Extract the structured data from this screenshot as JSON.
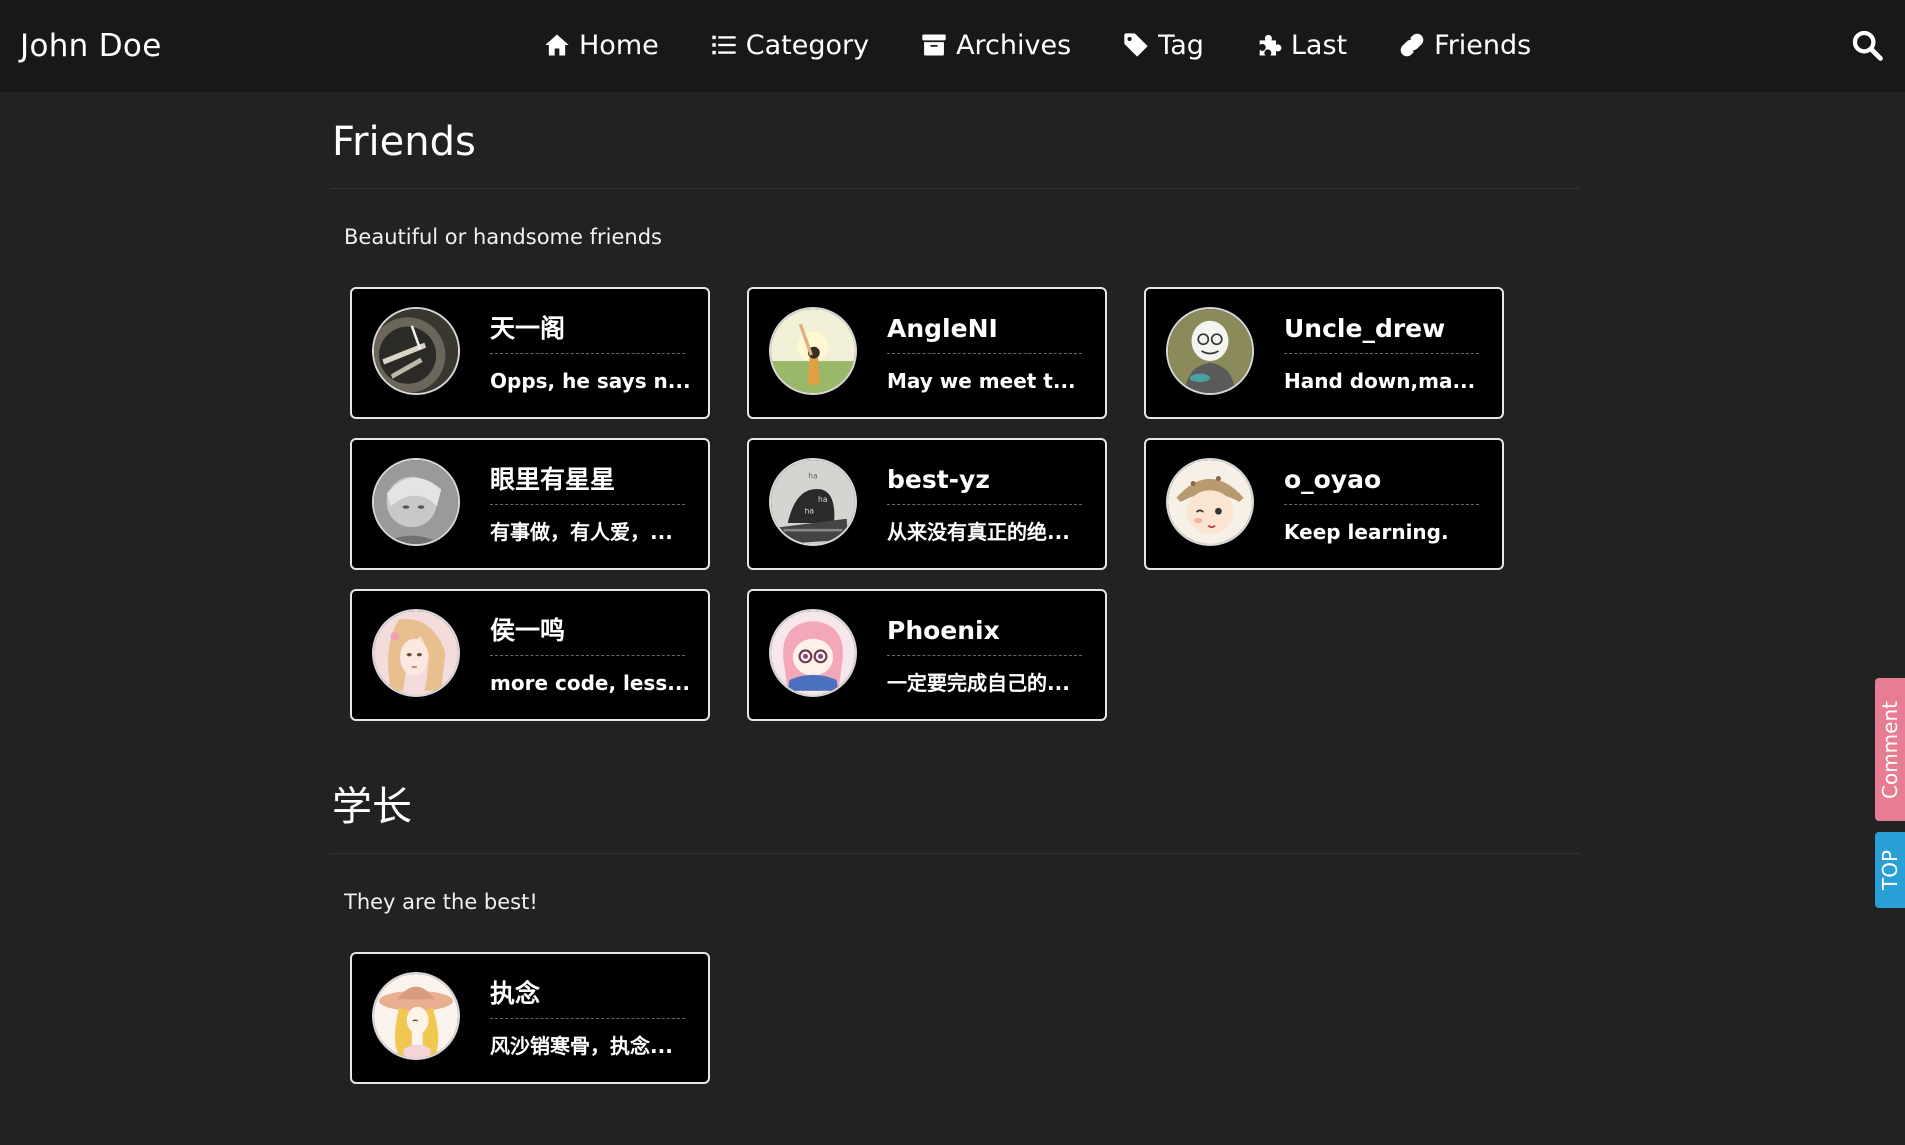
{
  "brand": "John Doe",
  "nav": [
    {
      "label": "Home",
      "icon": "home-icon"
    },
    {
      "label": "Category",
      "icon": "list-icon"
    },
    {
      "label": "Archives",
      "icon": "archive-icon"
    },
    {
      "label": "Tag",
      "icon": "tag-icon"
    },
    {
      "label": "Last",
      "icon": "puzzle-icon"
    },
    {
      "label": "Friends",
      "icon": "link-icon"
    }
  ],
  "search_icon": "search-icon",
  "sections": [
    {
      "title": "Friends",
      "description": "Beautiful or handsome friends",
      "friends": [
        {
          "name": "天一阁",
          "desc": "Opps, he says n..."
        },
        {
          "name": "AngleNI",
          "desc": "May we meet t..."
        },
        {
          "name": "Uncle_drew",
          "desc": "Hand down,ma..."
        },
        {
          "name": "眼里有星星",
          "desc": "有事做，有人爱，..."
        },
        {
          "name": "best-yz",
          "desc": "从来没有真正的绝..."
        },
        {
          "name": "o_oyao",
          "desc": "Keep learning."
        },
        {
          "name": "侯一鸣",
          "desc": "more code, less..."
        },
        {
          "name": "Phoenix",
          "desc": "一定要完成自己的..."
        }
      ]
    },
    {
      "title": "学长",
      "description": "They are the best!",
      "friends": [
        {
          "name": "执念",
          "desc": "风沙销寒骨，执念..."
        }
      ]
    }
  ],
  "side_tabs": {
    "comment": "Comment",
    "top": "TOP"
  },
  "colors": {
    "background": "#222222",
    "navbar": "#181818",
    "card": "#000000",
    "comment_tab": "#e67d92",
    "top_tab": "#2a9fd6"
  }
}
